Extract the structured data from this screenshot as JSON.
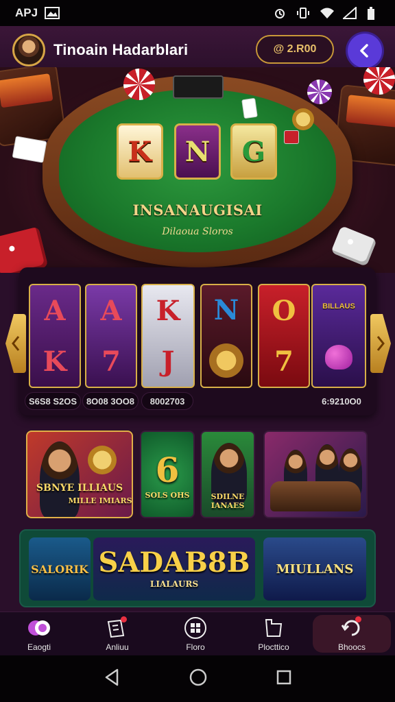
{
  "status_bar": {
    "left_text": "APJ",
    "left_icon": "gallery-icon",
    "right_icons": [
      "alarm-icon",
      "vibrate-icon",
      "wifi-icon",
      "signal-icon",
      "battery-icon"
    ]
  },
  "header": {
    "title": "Tinoain Hadarblari",
    "balance": "@ 2.R00",
    "avatar_icon": "avatar",
    "back_icon": "back-chevron-icon"
  },
  "hero": {
    "reel_letters": [
      "K",
      "N",
      "G"
    ],
    "table_title": "INSANAUGISAI",
    "table_subtitle": "Dilaoua Sloros"
  },
  "slot_reels": {
    "columns": [
      {
        "top": "A",
        "bottom": "K"
      },
      {
        "top": "A",
        "bottom": "7"
      },
      {
        "top": "K",
        "bottom": "J"
      },
      {
        "top": "N",
        "bottom": ""
      },
      {
        "top": "O",
        "bottom": "7"
      },
      {
        "top": "",
        "bottom": "",
        "tag": "BILLAUS"
      }
    ],
    "win_labels": [
      "S6S8 S2OS",
      "8O08 3OO8",
      "8002703",
      "6:9210O0"
    ],
    "left_arrow": "chevron-left-icon",
    "right_arrow": "chevron-right-icon"
  },
  "game_tiles": [
    {
      "label": "SBNYE ILLIAUS",
      "sub": "MILLE IMIARS"
    },
    {
      "label": "6",
      "sub": "SOLS OHS"
    },
    {
      "label": "SDILNE IANAES"
    },
    {
      "label": ""
    }
  ],
  "banners": {
    "left": "SALORIK",
    "main": "SADAB8B",
    "main_sub": "LIALAURS",
    "right": "MIULLANS"
  },
  "bottom_nav": [
    {
      "label": "Eaogti",
      "icon": "chips-icon",
      "badge": false,
      "active": false
    },
    {
      "label": "Anliuu",
      "icon": "cards-icon",
      "badge": true,
      "active": false
    },
    {
      "label": "Floro",
      "icon": "grid-icon",
      "badge": false,
      "active": false
    },
    {
      "label": "Plocttico",
      "icon": "bag-icon",
      "badge": false,
      "active": false
    },
    {
      "label": "Bhoocs",
      "icon": "refresh-icon",
      "badge": true,
      "active": true
    }
  ]
}
